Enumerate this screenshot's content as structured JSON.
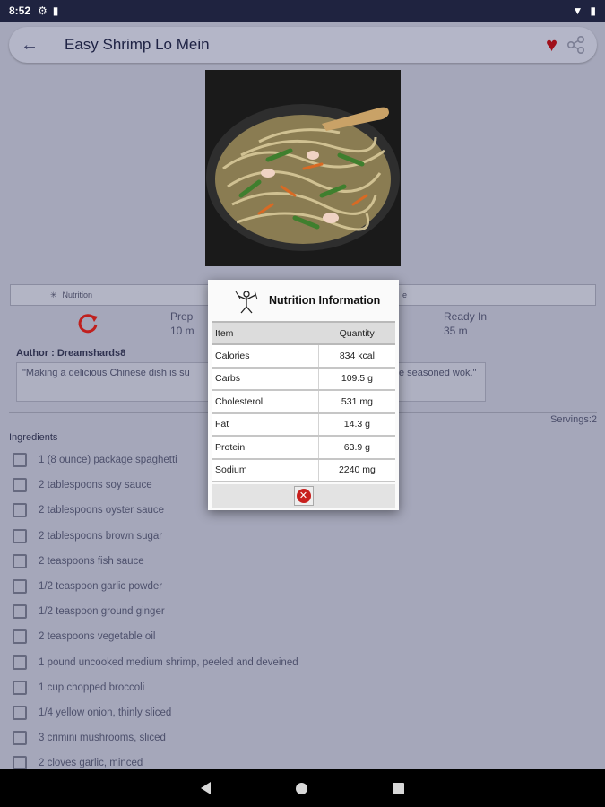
{
  "status_bar": {
    "time": "8:52"
  },
  "toolbar": {
    "title": "Easy Shrimp Lo Mein"
  },
  "tabs_strip": {
    "first_tab": "Nutrition",
    "right_tab_fragment": "e"
  },
  "stats": {
    "prep_label": "Prep",
    "prep_value": "10 m",
    "ready_label": "Ready In",
    "ready_value": "35 m"
  },
  "author": "Author : Dreamshards8",
  "description": {
    "left": "\"Making a delicious Chinese dish is su",
    "right": "e seasoned wok.\""
  },
  "servings": "Servings:2",
  "ingredients_title": "Ingredients",
  "ingredients": [
    "1 (8 ounce) package spaghetti",
    "2 tablespoons soy sauce",
    "2 tablespoons oyster sauce",
    "2 tablespoons brown sugar",
    "2 teaspoons fish sauce",
    "1/2 teaspoon garlic powder",
    "1/2 teaspoon ground ginger",
    "2 teaspoons vegetable oil",
    "1 pound uncooked medium shrimp, peeled and deveined",
    "1 cup chopped broccoli",
    "1/4 yellow onion, thinly sliced",
    "3 crimini mushrooms, sliced",
    "2 cloves garlic, minced"
  ],
  "dialog": {
    "title": "Nutrition Information",
    "col_item": "Item",
    "col_quantity": "Quantity",
    "rows": [
      {
        "item": "Calories",
        "quantity": "834 kcal"
      },
      {
        "item": "Carbs",
        "quantity": "109.5 g"
      },
      {
        "item": "Cholesterol",
        "quantity": "531 mg"
      },
      {
        "item": "Fat",
        "quantity": "14.3 g"
      },
      {
        "item": "Protein",
        "quantity": "63.9 g"
      },
      {
        "item": "Sodium",
        "quantity": "2240 mg"
      }
    ]
  },
  "colors": {
    "heart": "#a0101a",
    "close": "#c8201e",
    "refresh": "#c0201e",
    "scrim": "#a5a7ba"
  }
}
